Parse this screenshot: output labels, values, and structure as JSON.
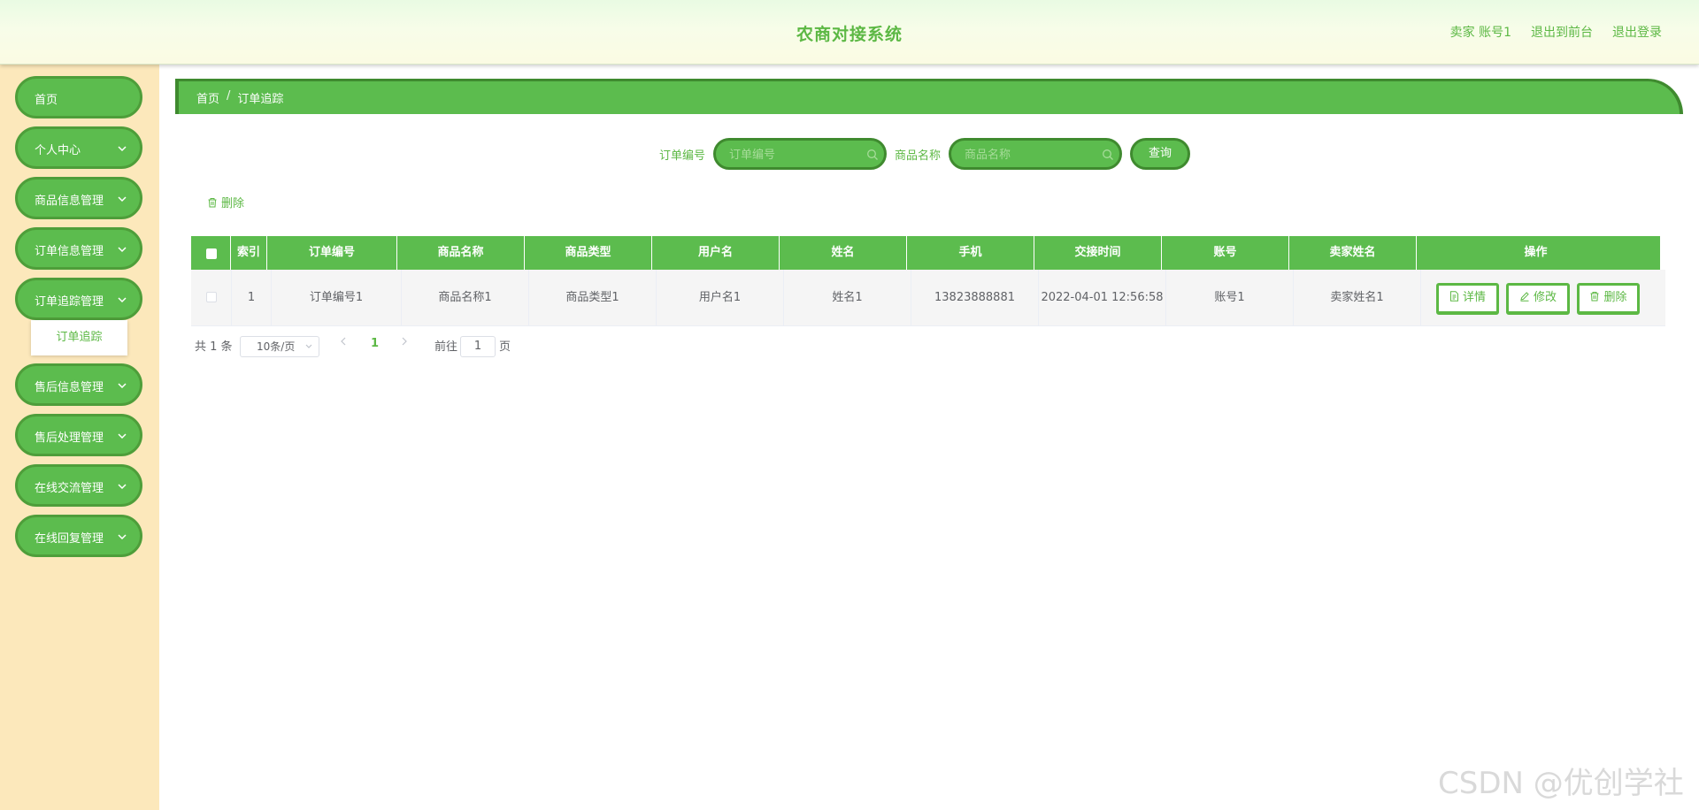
{
  "header": {
    "title": "农商对接系统",
    "user": "卖家 账号1",
    "back_to_front": "退出到前台",
    "logout": "退出登录"
  },
  "sidebar": {
    "items": [
      {
        "label": "首页",
        "has_chevron": false
      },
      {
        "label": "个人中心",
        "has_chevron": true
      },
      {
        "label": "商品信息管理",
        "has_chevron": true
      },
      {
        "label": "订单信息管理",
        "has_chevron": true
      },
      {
        "label": "订单追踪管理",
        "has_chevron": true,
        "expanded": true
      },
      {
        "label": "售后信息管理",
        "has_chevron": true
      },
      {
        "label": "售后处理管理",
        "has_chevron": true
      },
      {
        "label": "在线交流管理",
        "has_chevron": true
      },
      {
        "label": "在线回复管理",
        "has_chevron": true
      }
    ],
    "submenu": [
      "订单追踪"
    ]
  },
  "breadcrumb": {
    "home": "首页",
    "separator": "/",
    "current": "订单追踪"
  },
  "search": {
    "order_no_label": "订单编号",
    "order_no_placeholder": "订单编号",
    "order_no_value": "",
    "product_label": "商品名称",
    "product_placeholder": "商品名称",
    "product_value": "",
    "query_button": "查询"
  },
  "toolbar": {
    "delete_label": "删除"
  },
  "table": {
    "columns": [
      "索引",
      "订单编号",
      "商品名称",
      "商品类型",
      "用户名",
      "姓名",
      "手机",
      "交接时间",
      "账号",
      "卖家姓名",
      "操作"
    ],
    "rows": [
      {
        "index": "1",
        "order_no": "订单编号1",
        "product_name": "商品名称1",
        "product_type": "商品类型1",
        "username": "用户名1",
        "name": "姓名1",
        "phone": "13823888881",
        "handover_time": "2022-04-01 12:56:58",
        "account": "账号1",
        "seller_name": "卖家姓名1",
        "actions": {
          "detail": "详情",
          "edit": "修改",
          "delete": "删除"
        }
      }
    ]
  },
  "pagination": {
    "total_text": "共 1 条",
    "page_size": "10条/页",
    "current_page": "1",
    "goto_label": "前往",
    "goto_value": "1",
    "page_unit": "页"
  },
  "watermark": "CSDN @优创学社",
  "colors": {
    "primary_green": "#5cbc4e",
    "dark_green": "#3f8a2f",
    "sidebar_bg": "#fce8bb",
    "text_green": "#5cb844"
  }
}
